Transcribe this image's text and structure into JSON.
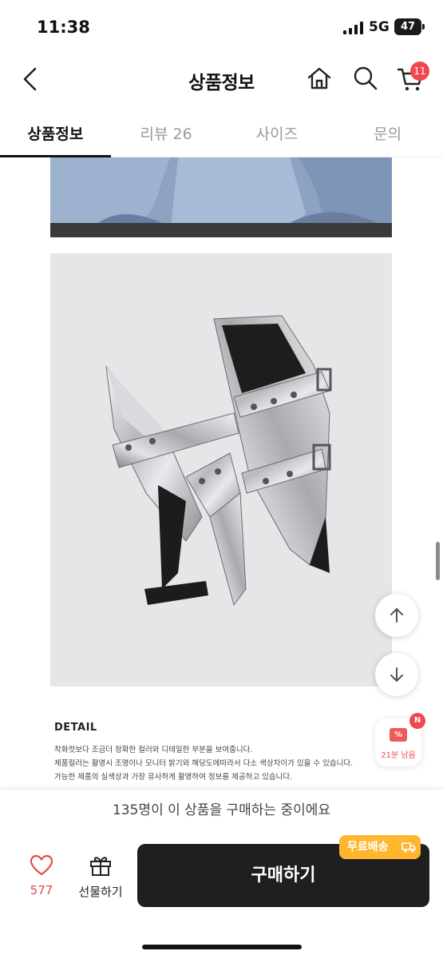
{
  "status": {
    "time": "11:38",
    "network": "5G",
    "battery": "47"
  },
  "header": {
    "title": "상품정보",
    "cart_count": "11"
  },
  "tabs": [
    {
      "label": "상품정보"
    },
    {
      "label": "리뷰 26"
    },
    {
      "label": "사이즈"
    },
    {
      "label": "문의"
    }
  ],
  "detail": {
    "heading": "DETAIL",
    "lines": [
      "착화컷보다 조금더 정확한 컬러와 디테일한 부분을 보여줍니다.",
      "제품컬러는 촬영시 조명이나 모니터 밝기와 해당도에따라서 다소 색상차이가 있을 수 있습니다.",
      "가능한 제품의 실색상과 가장 유사하게 촬영하여 정보를 제공하고 있습니다."
    ]
  },
  "coupon": {
    "badge": "N",
    "text": "21분 남음",
    "icon_text": "%"
  },
  "banner": {
    "text": "135명이 이 상품을 구매하는 중이에요"
  },
  "bottom": {
    "like_count": "577",
    "gift_label": "선물하기",
    "buy_label": "구매하기",
    "free_shipping": "무료배송"
  },
  "colors": {
    "accent_red": "#f0484e",
    "free_ship": "#ffb62e",
    "buy_button": "#1f1f1f"
  }
}
